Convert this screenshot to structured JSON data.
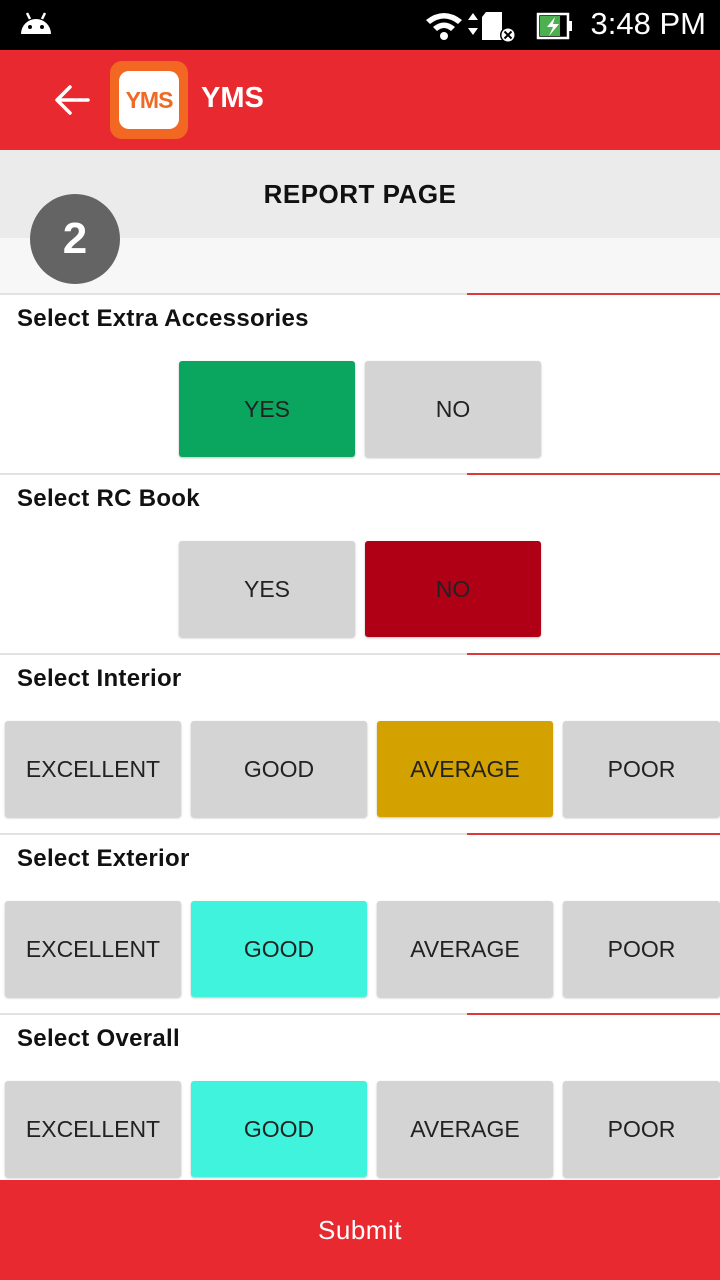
{
  "status_bar": {
    "time": "3:48 PM"
  },
  "app_bar": {
    "logo_text": "YMS",
    "title": "YMS"
  },
  "page": {
    "title": "REPORT PAGE",
    "step": "2"
  },
  "sections": [
    {
      "label": "Select Extra Accessories",
      "options": [
        "YES",
        "NO"
      ],
      "selected": "YES",
      "selected_color": "#0aa55e"
    },
    {
      "label": "Select RC Book",
      "options": [
        "YES",
        "NO"
      ],
      "selected": "NO",
      "selected_color": "#b00016"
    },
    {
      "label": "Select Interior",
      "options": [
        "EXCELLENT",
        "GOOD",
        "AVERAGE",
        "POOR"
      ],
      "selected": "AVERAGE",
      "selected_color": "#d4a200"
    },
    {
      "label": "Select Exterior",
      "options": [
        "EXCELLENT",
        "GOOD",
        "AVERAGE",
        "POOR"
      ],
      "selected": "GOOD",
      "selected_color": "#40f3dc"
    },
    {
      "label": "Select Overall",
      "options": [
        "EXCELLENT",
        "GOOD",
        "AVERAGE",
        "POOR"
      ],
      "selected": "GOOD",
      "selected_color": "#40f3dc"
    }
  ],
  "submit_label": "Submit",
  "colors": {
    "primary": "#e8292f",
    "unselected": "#d4d4d4",
    "header_bg": "#ebebeb"
  }
}
